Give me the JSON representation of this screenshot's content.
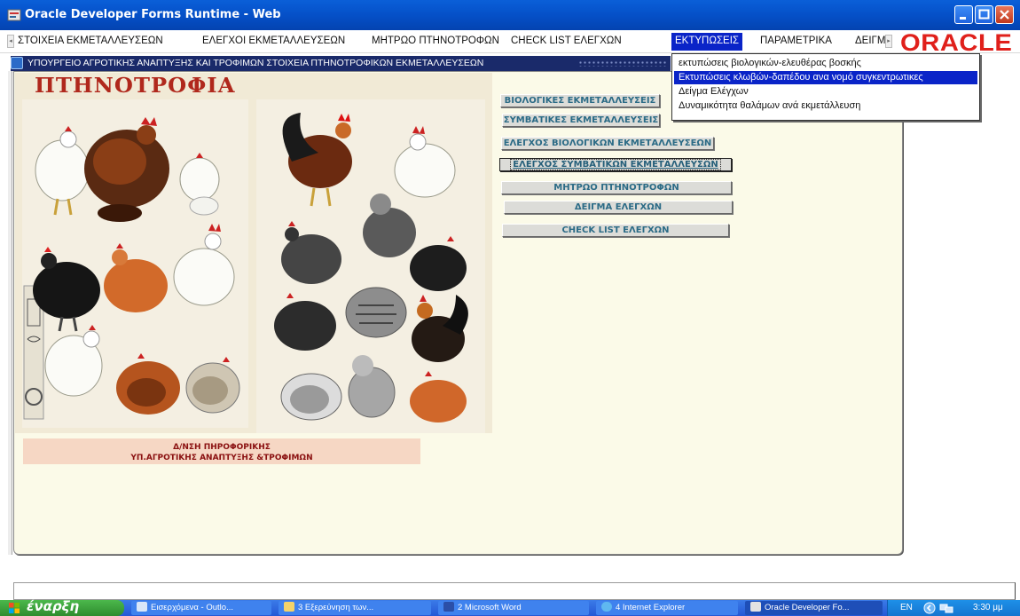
{
  "window": {
    "title": "Oracle Developer Forms Runtime - Web"
  },
  "menu": {
    "items": [
      {
        "label": "ΣΤΟΙΧΕΙΑ ΕΚΜΕΤΑΛΛΕΥΣΕΩΝ"
      },
      {
        "label": "ΕΛΕΓΧΟΙ ΕΚΜΕΤΑΛΛΕΥΣΕΩΝ"
      },
      {
        "label": "ΜΗΤΡΩΟ ΠΤΗΝΟΤΡΟΦΩΝ"
      },
      {
        "label": "CHECK LIST ΕΛΕΓΧΩΝ"
      },
      {
        "label": "ΕΚΤΥΠΩΣΕΙΣ"
      },
      {
        "label": "ΠΑΡΑΜΕΤΡΙΚΑ"
      },
      {
        "label": "ΔΕΙΓΜ"
      }
    ],
    "brand": "ORACLE"
  },
  "desktop_title": "ΥΠΟΥΡΓΕΙΟ ΑΓΡΟΤΙΚΗΣ ΑΝΑΠΤΥΞΗΣ ΚΑΙ ΤΡΟΦΙΜΩΝ ΣΤΟΙΧΕΙΑ ΠΤΗΝΟΤΡΟΦΙΚΩΝ ΕΚΜΕΤΑΛΛΕΥΣΕΩΝ",
  "poster": {
    "title": "ΠΤΗΝΟΤΡΟΦΙΑ"
  },
  "buttons": [
    {
      "label": "ΒΙΟΛΟΓΙΚΕΣ ΕΚΜΕΤΑΛΛΕΥΣΕΙΣ"
    },
    {
      "label": "ΣΥΜΒΑΤΙΚΕΣ ΕΚΜΕΤΑΛΛΕΥΣΕΙΣ"
    },
    {
      "label": "ΕΛΕΓΧΟΣ ΒΙΟΛΟΓΙΚΩΝ ΕΚΜΕΤΑΛΛΕΥΣΕΩΝ"
    },
    {
      "label": "ΕΛΕΓΧΟΣ ΣΥΜΒΑΤΙΚΩΝ ΕΚΜΕΤΑΛΛΕΥΣΩΝ"
    },
    {
      "label": "ΜΗΤΡΩΟ ΠΤΗΝΟΤΡΟΦΩΝ"
    },
    {
      "label": "ΔΕΙΓΜΑ ΕΛΕΓΧΩΝ"
    },
    {
      "label": "CHECK LIST ΕΛΕΓΧΩΝ"
    }
  ],
  "dropdown": {
    "items": [
      {
        "label": "εκτυπώσεις βιολογικών-ελευθέρας βοσκής"
      },
      {
        "label": "Εκτυπώσεις κλωβών-δαπέδου ανα νομό συγκεντρωτικες"
      },
      {
        "label": "Δείγμα Ελέγχων"
      },
      {
        "label": "Δυναμικότητα θαλάμων ανά εκμετάλλευση"
      }
    ]
  },
  "footer": {
    "line1": "Δ/ΝΣΗ ΠΗΡΟΦΟΡΙΚΗΣ",
    "line2": "ΥΠ.ΑΓΡΟΤΙΚΗΣ ΑΝΑΠΤΥΞΗΣ &ΤΡΟΦΙΜΩΝ"
  },
  "taskbar": {
    "start": "έναρξη",
    "tasks": [
      {
        "label": "Εισερχόμενα - Outlo..."
      },
      {
        "label": "3 Εξερεύνηση των..."
      },
      {
        "label": "2 Microsoft Word"
      },
      {
        "label": "4 Internet Explorer"
      },
      {
        "label": "Oracle Developer Fo..."
      }
    ],
    "lang": "EN",
    "clock": "3:30 μμ"
  }
}
